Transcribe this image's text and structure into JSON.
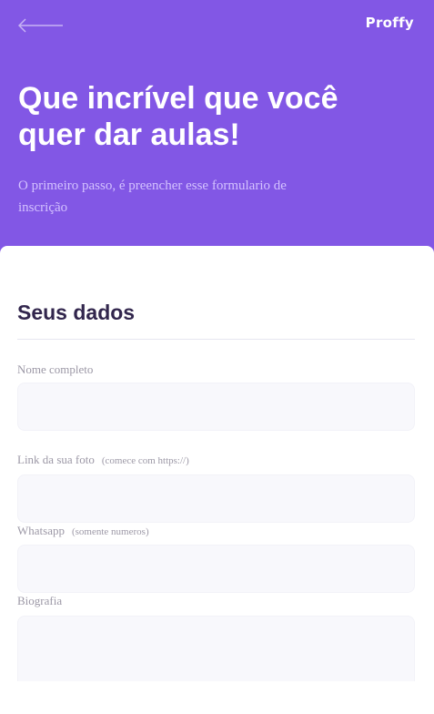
{
  "header": {
    "logo": "Proffy",
    "title": "Que incrível que você quer dar aulas!",
    "subtitle": "O primeiro passo, é preencher esse formulario de inscrição"
  },
  "form": {
    "section_title": "Seus dados",
    "fields": [
      {
        "label": "Nome completo",
        "hint": "",
        "value": ""
      },
      {
        "label": "Link da sua foto",
        "hint": "(comece com https://)",
        "value": ""
      },
      {
        "label": "Whatsapp",
        "hint": "(somente numeros)",
        "value": ""
      },
      {
        "label": "Biografia",
        "hint": "",
        "value": ""
      }
    ]
  },
  "colors": {
    "primary": "#8257e5",
    "title_text": "#32264d",
    "label_text": "#9c98a6",
    "input_bg": "#f8f8fc"
  },
  "icons": {
    "back": "arrow-left-icon"
  }
}
